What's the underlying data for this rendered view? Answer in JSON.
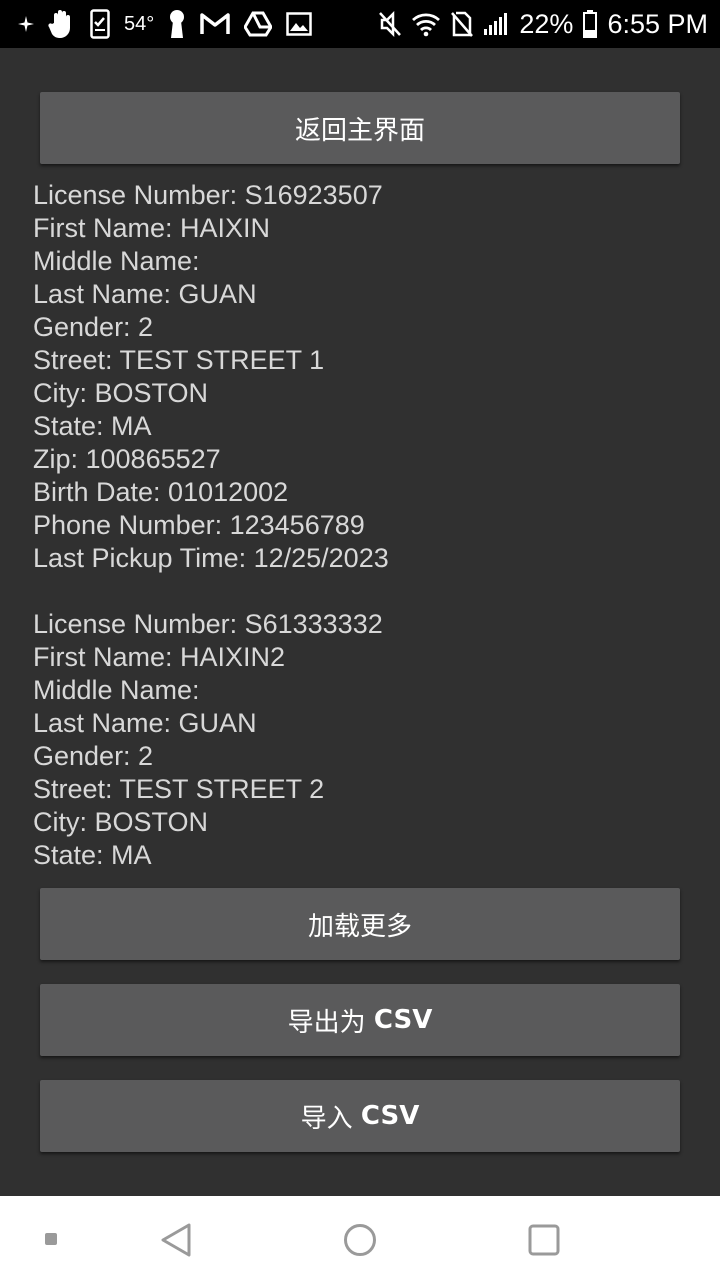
{
  "status_bar": {
    "temperature": "54°",
    "battery_percent": "22%",
    "time": "6:55 PM",
    "left_icons": [
      "sparkle-notification-icon",
      "hand-icon",
      "phone-clipboard-icon",
      "keyhole-icon",
      "gmail-icon",
      "drive-icon",
      "gallery-icon"
    ],
    "right_icons": [
      "mute-icon",
      "wifi-icon",
      "no-sim-icon",
      "signal-icon",
      "battery-icon"
    ]
  },
  "buttons": {
    "back_home": "返回主界面",
    "load_more": "加载更多",
    "export_csv_prefix": "导出为",
    "export_csv_suffix": "CSV",
    "import_csv_prefix": "导入",
    "import_csv_suffix": "CSV"
  },
  "records": [
    {
      "license": "License Number: S16923507",
      "first_name": "First Name: HAIXIN",
      "middle_name": "Middle Name:",
      "last_name": "Last Name: GUAN",
      "gender": "Gender: 2",
      "street": "Street: TEST STREET 1",
      "city": "City: BOSTON",
      "state": "State: MA",
      "zip": "Zip: 100865527",
      "birth_date": "Birth Date: 01012002",
      "phone": "Phone Number: 123456789",
      "last_pickup": "Last Pickup Time: 12/25/2023"
    },
    {
      "license": "License Number: S61333332",
      "first_name": "First Name: HAIXIN2",
      "middle_name": "Middle Name:",
      "last_name": "Last Name: GUAN",
      "gender": "Gender: 2",
      "street": "Street: TEST STREET 2",
      "city": "City: BOSTON",
      "state": "State: MA"
    }
  ],
  "nav_bar": {
    "items": [
      "recents-dot-icon",
      "back-icon",
      "home-icon",
      "overview-icon"
    ]
  },
  "colors": {
    "background": "#303030",
    "button": "#5a5a5b",
    "text": "#d8d8d8",
    "status_bar": "#000000",
    "nav_bar": "#ffffff"
  }
}
